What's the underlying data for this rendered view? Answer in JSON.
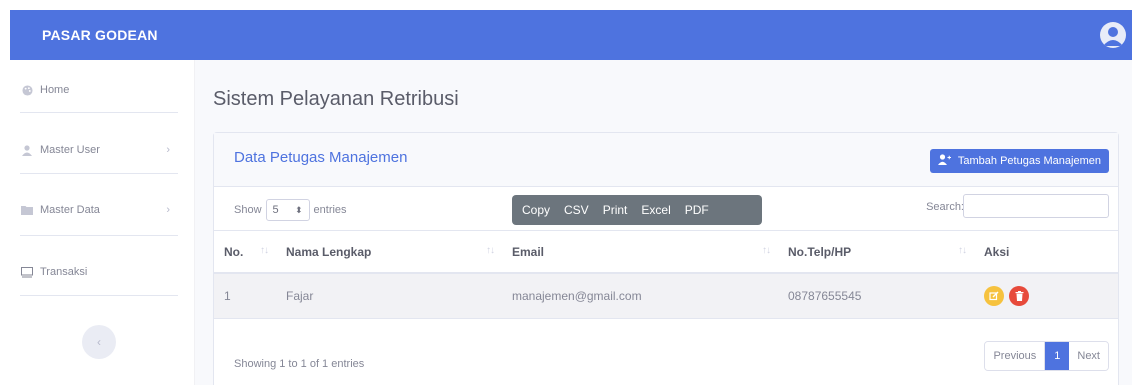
{
  "app": {
    "brand": "PASAR GODEAN"
  },
  "sidebar": {
    "items": [
      {
        "label": "Home",
        "icon": "palette-icon"
      },
      {
        "label": "Master User",
        "icon": "user-icon",
        "chevron": true
      },
      {
        "label": "Master Data",
        "icon": "folder-icon",
        "chevron": true
      },
      {
        "label": "Transaksi",
        "icon": "monitor-icon"
      }
    ]
  },
  "page": {
    "title": "Sistem Pelayanan Retribusi"
  },
  "card": {
    "title": "Data Petugas Manajemen",
    "add_button": "Tambah Petugas Manajemen"
  },
  "table_controls": {
    "show_label": "Show",
    "entries_label": "entries",
    "page_size": "5",
    "export_buttons": [
      "Copy",
      "CSV",
      "Print",
      "Excel",
      "PDF"
    ],
    "search_label": "Search:"
  },
  "table": {
    "columns": [
      "No.",
      "Nama Lengkap",
      "Email",
      "No.Telp/HP",
      "Aksi"
    ],
    "rows": [
      {
        "no": "1",
        "nama": "Fajar",
        "email": "manajemen@gmail.com",
        "telp": "08787655545"
      }
    ]
  },
  "footer": {
    "info": "Showing 1 to 1 of 1 entries",
    "pagination": {
      "previous": "Previous",
      "current": "1",
      "next": "Next"
    }
  },
  "colors": {
    "primary": "#4e73df",
    "secondary": "#6c757d",
    "warning": "#f6c23e",
    "danger": "#e74a3b"
  }
}
